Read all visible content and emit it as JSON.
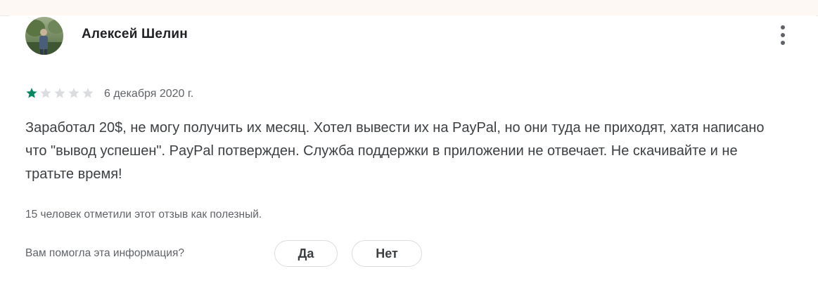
{
  "review": {
    "author": "Алексей Шелин",
    "rating": 1,
    "max_rating": 5,
    "date": "6 декабря 2020 г.",
    "text": "Заработал 20$, не могу получить их месяц. Хотел вывести их на PayPal, но они туда не приходят, хатя написано что \"вывод успешен\". PayPal потвержден. Служба поддержки в приложении не отвечает. Не скачивайте и не тратьте время!",
    "helpful_count_text": "15 человек отметили этот отзыв как полезный."
  },
  "feedback": {
    "question": "Вам помогла эта информация?",
    "yes_label": "Да",
    "no_label": "Нет"
  },
  "icons": {
    "menu": "more-vert-icon",
    "star": "star-icon"
  },
  "colors": {
    "star_filled": "#01875f",
    "star_empty": "#dadce0"
  }
}
